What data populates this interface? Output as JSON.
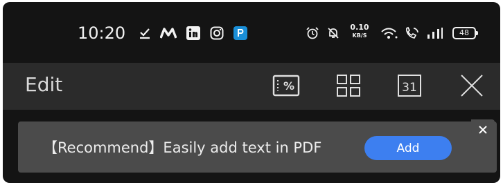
{
  "status_bar": {
    "time": "10:20",
    "network_speed_value": "0.10",
    "network_speed_unit": "KB/S",
    "battery_level": "48",
    "icons": [
      "download-done-icon",
      "m-app-icon",
      "linkedin-icon",
      "instagram-icon",
      "paytm-icon",
      "alarm-icon",
      "mute-icon",
      "wifi-icon",
      "wifi-calling-icon",
      "signal-icon",
      "battery-icon"
    ]
  },
  "toolbar": {
    "title": "Edit",
    "actions": [
      "percent-icon",
      "grid-icon",
      "calendar-icon",
      "close-icon"
    ]
  },
  "banner": {
    "text": "【Recommend】Easily add text in PDF",
    "button_label": "Add",
    "accent_color": "#3d7ff0"
  },
  "colors": {
    "background": "#141414",
    "toolbar": "#2b2b2b",
    "banner": "#4b4b4b"
  }
}
